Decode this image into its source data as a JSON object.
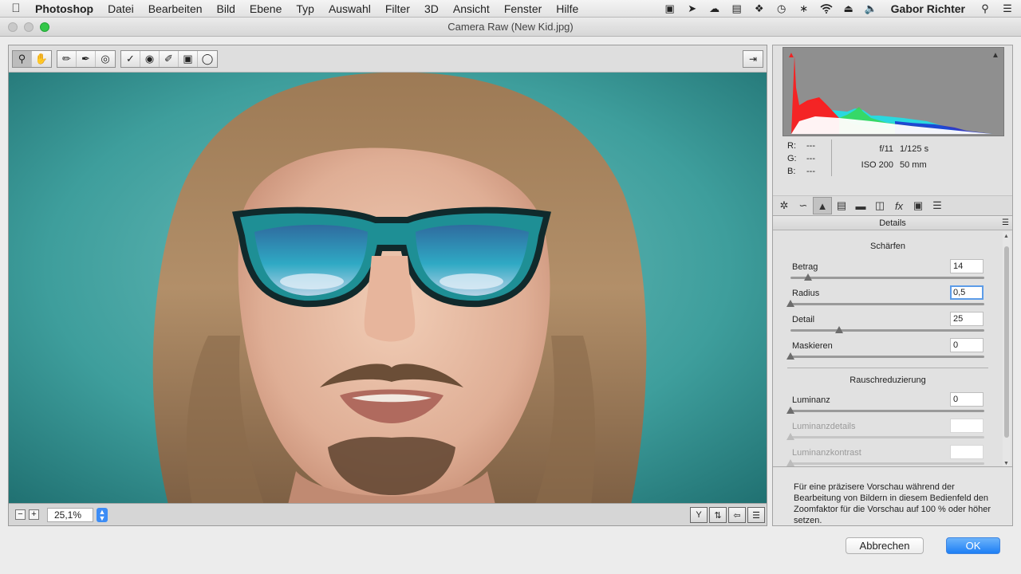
{
  "menubar": {
    "apple_icon": "apple-icon",
    "items": [
      "Photoshop",
      "Datei",
      "Bearbeiten",
      "Bild",
      "Ebene",
      "Typ",
      "Auswahl",
      "Filter",
      "3D",
      "Ansicht",
      "Fenster",
      "Hilfe"
    ],
    "user": "Gabor Richter",
    "status_icons": [
      "cast-icon",
      "play-icon",
      "cloud-icon",
      "monitor-icon",
      "dropbox-icon",
      "time-machine-icon",
      "bluetooth-icon",
      "wifi-icon",
      "eject-icon",
      "volume-icon"
    ]
  },
  "window": {
    "title": "Camera Raw (New Kid.jpg)"
  },
  "toolbar": {
    "tools": [
      "zoom-tool",
      "hand-tool",
      "white-balance-tool",
      "color-sampler-tool",
      "target-adjustment-tool",
      "spot-removal-tool",
      "red-eye-tool",
      "adjustment-brush-tool",
      "graduated-filter-tool",
      "radial-filter-tool"
    ],
    "active_tool": "zoom-tool"
  },
  "preview": {
    "zoom_value": "25,1%"
  },
  "readout": {
    "r_label": "R:",
    "r_value": "---",
    "g_label": "G:",
    "g_value": "---",
    "b_label": "B:",
    "b_value": "---",
    "aperture": "f/11",
    "shutter": "1/125 s",
    "iso": "ISO 200",
    "focal": "50 mm"
  },
  "panel": {
    "title": "Details",
    "active_tab": 2,
    "tab_icons": [
      "basic-icon",
      "tone-curve-icon",
      "detail-icon",
      "hsl-icon",
      "split-toning-icon",
      "lens-icon",
      "effects-icon",
      "camera-calibration-icon",
      "presets-icon"
    ]
  },
  "sharpen": {
    "title": "Schärfen",
    "sliders": [
      {
        "label": "Betrag",
        "value": "14",
        "fraction": 0.09
      },
      {
        "label": "Radius",
        "value": "0,5",
        "fraction": 0.0
      },
      {
        "label": "Detail",
        "value": "25",
        "fraction": 0.25
      },
      {
        "label": "Maskieren",
        "value": "0",
        "fraction": 0.0
      }
    ]
  },
  "noise": {
    "title": "Rauschreduzierung",
    "sliders": [
      {
        "label": "Luminanz",
        "value": "0",
        "fraction": 0.0
      },
      {
        "label": "Luminanzdetails",
        "value": "",
        "fraction": 0.0
      },
      {
        "label": "Luminanzkontrast",
        "value": "",
        "fraction": 0.0
      }
    ]
  },
  "hint": "Für eine präzisere Vorschau während der Bearbeitung von Bildern in diesem Bedienfeld den Zoomfaktor für die Vorschau auf 100 % oder höher setzen.",
  "buttons": {
    "cancel": "Abbrechen",
    "ok": "OK"
  },
  "colors": {
    "accent": "#1e7ff5",
    "background_teal": "#3a9b9a"
  }
}
